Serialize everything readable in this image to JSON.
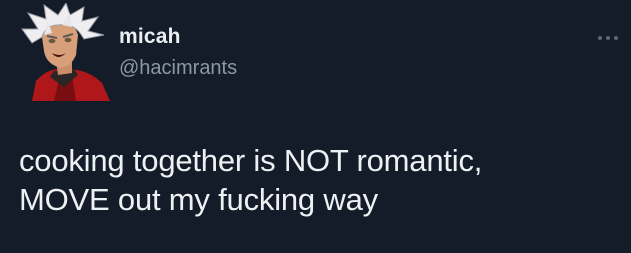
{
  "tweet": {
    "display_name": "micah",
    "handle": "@hacimrants",
    "more_icon": "more-horizontal-icon",
    "text_lines": [
      "cooking together is NOT romantic,",
      "MOVE out my fucking way"
    ]
  },
  "colors": {
    "background": "#141c29",
    "display_name": "#e9eef3",
    "handle": "#8a98a6",
    "body_text": "#eef1f4"
  }
}
